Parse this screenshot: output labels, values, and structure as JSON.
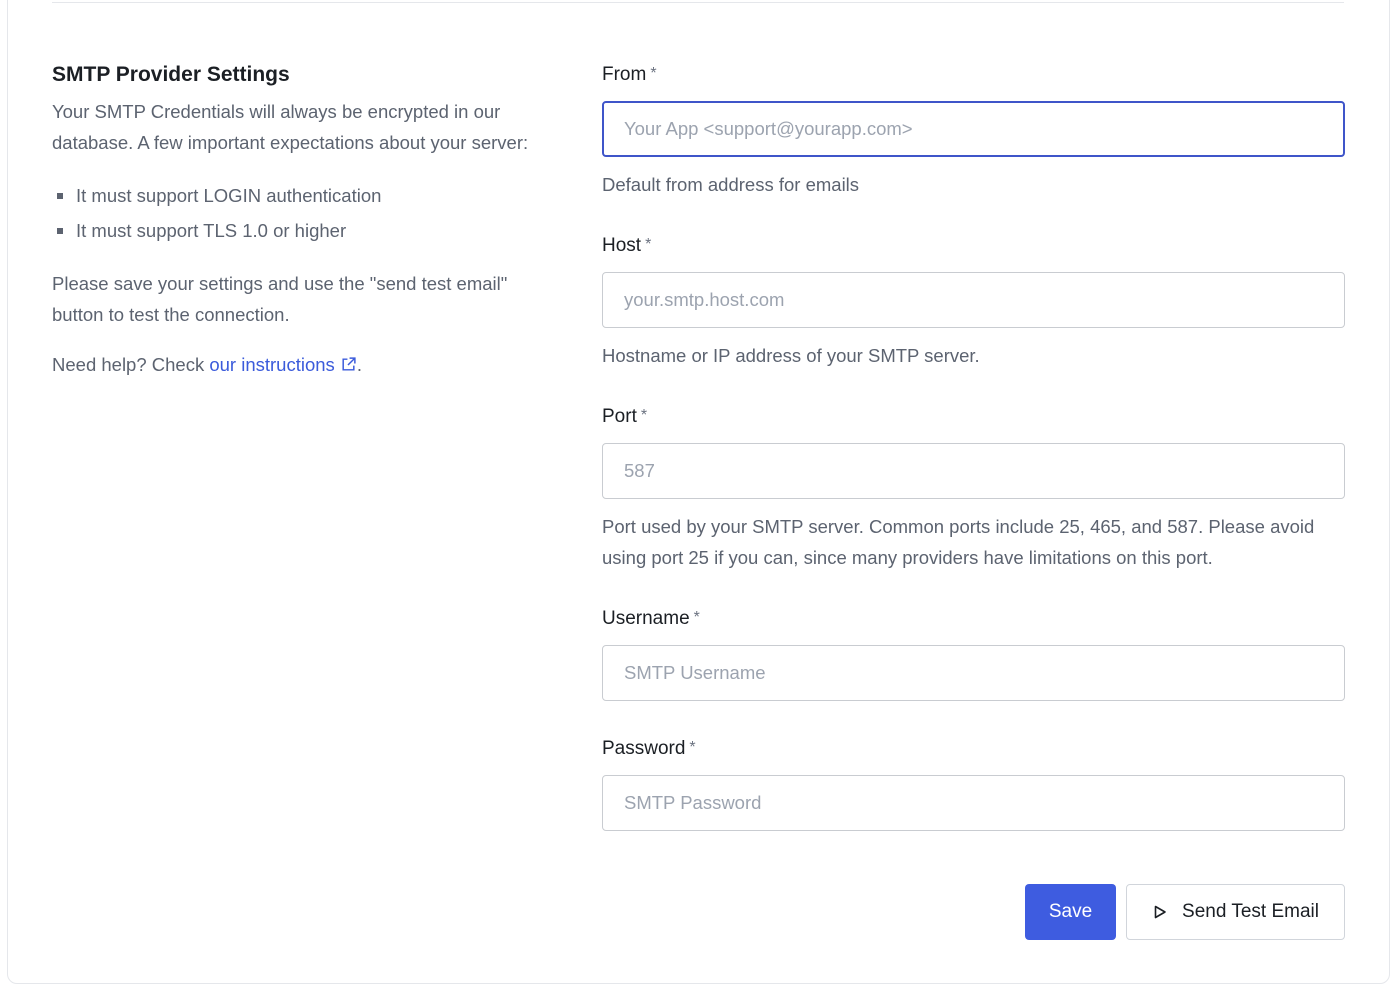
{
  "left": {
    "title": "SMTP Provider Settings",
    "lead": "Your SMTP Credentials will always be encrypted in our database. A few important expectations about your server:",
    "requirements": [
      "It must support LOGIN authentication",
      "It must support TLS 1.0 or higher"
    ],
    "note": "Please save your settings and use the \"send test email\" button to test the connection.",
    "help_prefix": "Need help? Check ",
    "help_link": "our instructions",
    "help_suffix": ".",
    "external_icon": "external-link-icon"
  },
  "fields": {
    "from": {
      "label": "From",
      "required": "*",
      "value": "",
      "placeholder": "Your App <support@yourapp.com>",
      "hint": "Default from address for emails"
    },
    "host": {
      "label": "Host",
      "required": "*",
      "value": "",
      "placeholder": "your.smtp.host.com",
      "hint": "Hostname or IP address of your SMTP server."
    },
    "port": {
      "label": "Port",
      "required": "*",
      "value": "",
      "placeholder": "587",
      "hint": "Port used by your SMTP server. Common ports include 25, 465, and 587. Please avoid using port 25 if you can, since many providers have limitations on this port."
    },
    "username": {
      "label": "Username",
      "required": "*",
      "value": "",
      "placeholder": "SMTP Username"
    },
    "password": {
      "label": "Password",
      "required": "*",
      "value": "",
      "placeholder": "SMTP Password"
    }
  },
  "actions": {
    "save_label": "Save",
    "test_label": "Send Test Email",
    "test_icon": "play-icon"
  },
  "colors": {
    "accent": "#3e5ce0",
    "link": "#3b5bdb",
    "focus_border": "#3f55c9"
  }
}
